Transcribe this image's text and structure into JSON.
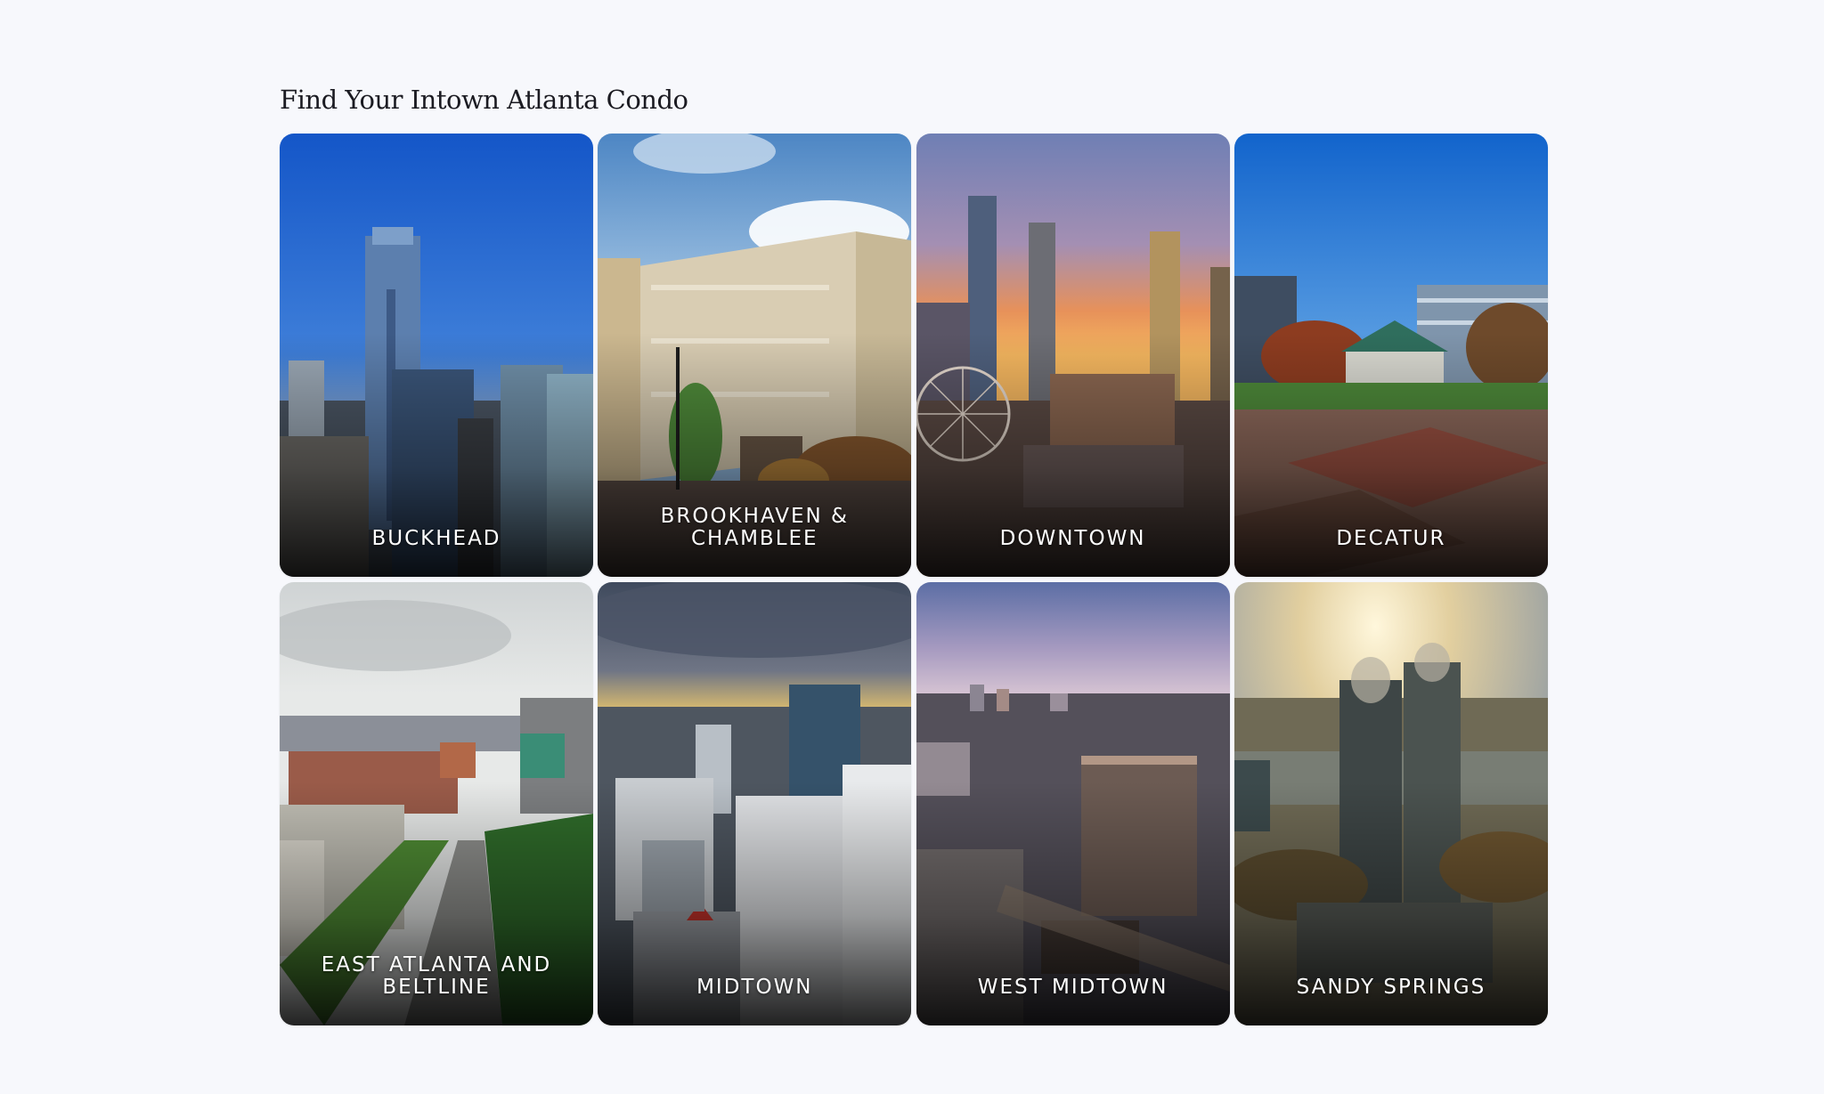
{
  "page": {
    "title": "Find Your Intown Atlanta Condo"
  },
  "neighborhoods": [
    {
      "label": "BUCKHEAD"
    },
    {
      "label": "BROOKHAVEN & CHAMBLEE"
    },
    {
      "label": "DOWNTOWN"
    },
    {
      "label": "DECATUR"
    },
    {
      "label": "EAST ATLANTA AND BELTLINE"
    },
    {
      "label": "MIDTOWN"
    },
    {
      "label": "WEST MIDTOWN"
    },
    {
      "label": "SANDY SPRINGS"
    }
  ]
}
